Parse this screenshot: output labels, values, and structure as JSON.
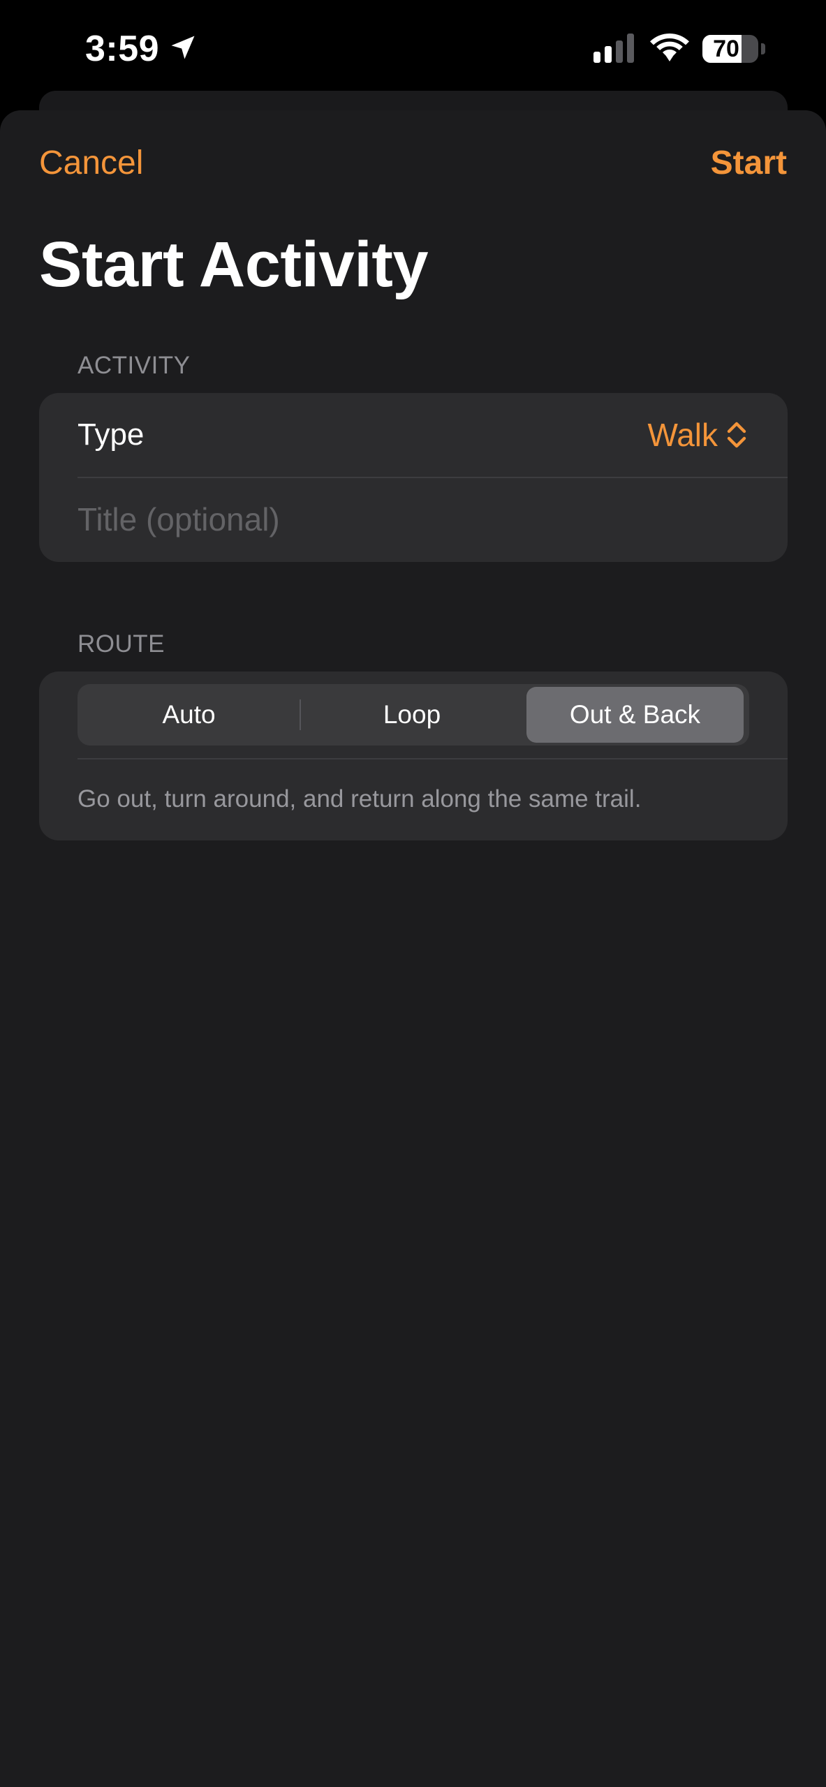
{
  "status_bar": {
    "time": "3:59",
    "battery_percent": 70,
    "battery_label": "70",
    "icons": [
      "location-arrow-icon",
      "cellular-signal-icon",
      "wifi-icon",
      "battery-icon"
    ]
  },
  "nav": {
    "cancel_label": "Cancel",
    "start_label": "Start"
  },
  "page": {
    "title": "Start Activity"
  },
  "activity_section": {
    "header": "ACTIVITY",
    "type_label": "Type",
    "type_value": "Walk",
    "type_icon": "chevron-up-down-icon",
    "title_value": "",
    "title_placeholder": "Title (optional)"
  },
  "route_section": {
    "header": "ROUTE",
    "options": [
      {
        "label": "Auto",
        "selected": false
      },
      {
        "label": "Loop",
        "selected": false
      },
      {
        "label": "Out & Back",
        "selected": true
      }
    ],
    "description": "Go out, turn around, and return along the same trail."
  },
  "colors": {
    "accent": "#f4953a",
    "background": "#1c1c1e",
    "grouped_cell": "#2c2c2e",
    "segment_selected": "#6c6c70",
    "secondary_text": "#8e8e93"
  }
}
